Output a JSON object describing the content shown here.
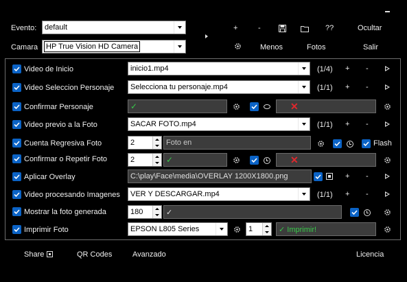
{
  "top": {
    "evento_label": "Evento:",
    "evento_value": "default",
    "camara_label": "Camara",
    "camara_value": "HP True Vision HD Camera",
    "plus": "+",
    "minus": "-",
    "help": "??",
    "ocultar": "Ocultar",
    "menos": "Menos",
    "fotos": "Fotos",
    "salir": "Salir"
  },
  "rows": [
    {
      "label": "Video de Inicio",
      "value": "inicio1.mp4",
      "count": "(1/4)"
    },
    {
      "label": "Video Seleccion Personaje",
      "value": "Selecciona tu personaje.mp4",
      "count": "(1/1)"
    },
    {
      "label": "Confirmar Personaje",
      "check_text": "✓",
      "x_text": "✕"
    },
    {
      "label": "Video previo a la Foto",
      "value": "SACAR FOTO.mp4",
      "count": "(1/1)"
    },
    {
      "label": "Cuenta Regresiva Foto",
      "num": "2",
      "text_value": "Foto en",
      "flash_label": "Flash"
    },
    {
      "label": "Confirmar o Repetir Foto",
      "num": "2",
      "check_text": "✓",
      "x_text": "✕"
    },
    {
      "label": "Aplicar Overlay",
      "path_value": "C:\\play\\Face\\media\\OVERLAY 1200X1800.png"
    },
    {
      "label": "Video procesando Imagenes",
      "value": "VER Y DESCARGAR.mp4",
      "count": "(1/1)"
    },
    {
      "label": "Mostrar la foto generada",
      "num": "180",
      "check_text": "✓"
    },
    {
      "label": "Imprimir Foto",
      "printer": "EPSON L805 Series",
      "num": "1",
      "print_text": "✓ Imprimir!"
    }
  ],
  "bottom": {
    "share": "Share",
    "qr": "QR Codes",
    "avanzado": "Avanzado",
    "licencia": "Licencia"
  },
  "colors": {
    "accent_checkbox": "#0b63c6",
    "ok_green": "#38c94a",
    "x_red": "#e0282d",
    "field_bg": "#3c3c3c"
  },
  "icons": [
    "checkbox-icon",
    "gear-icon",
    "clock-icon",
    "bubble-icon",
    "play-icon",
    "save-icon",
    "folder-icon",
    "camera-icon"
  ]
}
